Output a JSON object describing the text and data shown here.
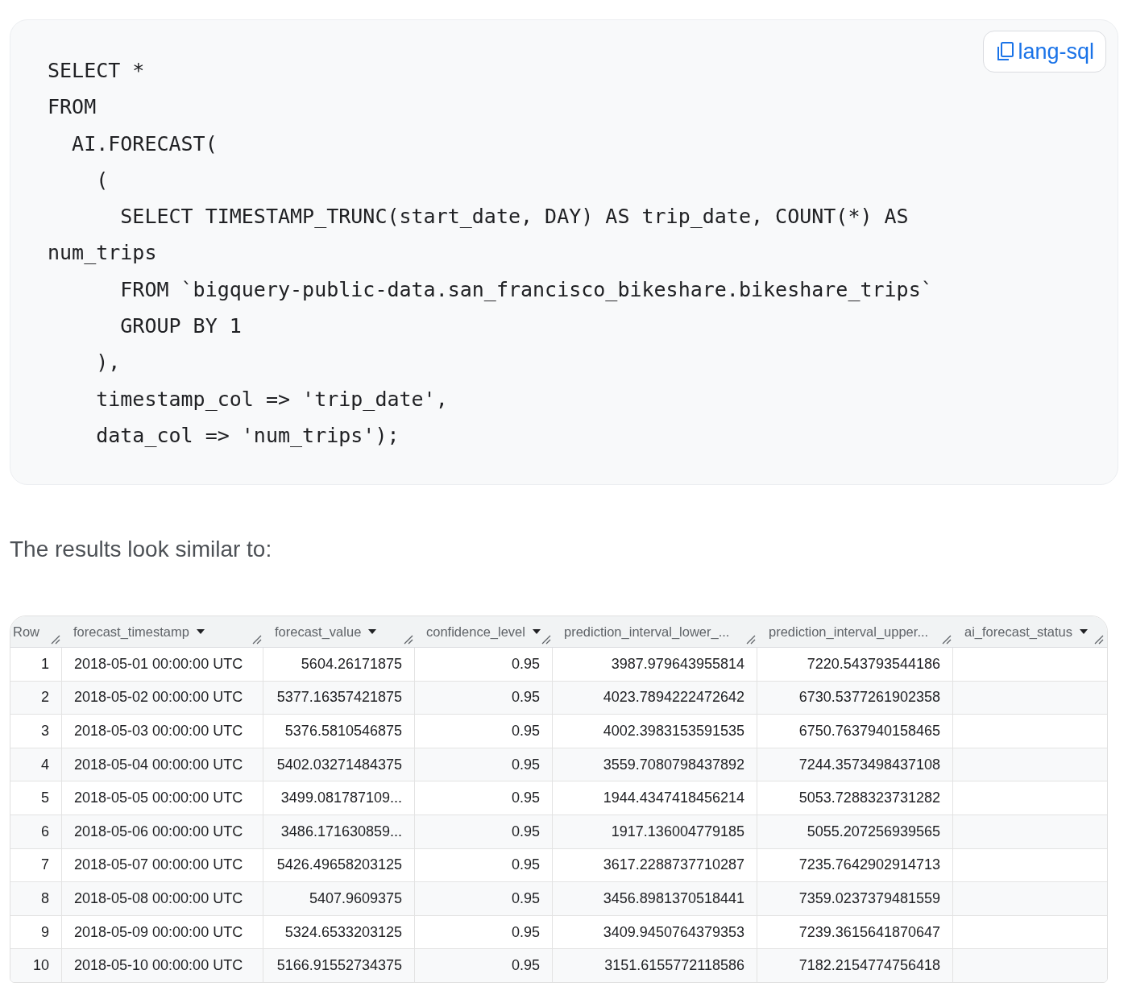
{
  "code_block": {
    "language_button": "lang-sql",
    "lines": [
      "SELECT *",
      "FROM",
      "  AI.FORECAST(",
      "    (",
      "      SELECT TIMESTAMP_TRUNC(start_date, DAY) AS trip_date, COUNT(*) AS",
      "num_trips",
      "      FROM `bigquery-public-data.san_francisco_bikeshare.bikeshare_trips`",
      "      GROUP BY 1",
      "    ),",
      "    timestamp_col => 'trip_date',",
      "    data_col => 'num_trips');"
    ]
  },
  "intro_text": "The results look similar to:",
  "table": {
    "columns": [
      {
        "label": "Row",
        "dropdown": false
      },
      {
        "label": "forecast_timestamp",
        "dropdown": true
      },
      {
        "label": "forecast_value",
        "dropdown": true
      },
      {
        "label": "confidence_level",
        "dropdown": true
      },
      {
        "label": "prediction_interval_lower_...",
        "dropdown": false
      },
      {
        "label": "prediction_interval_upper...",
        "dropdown": false
      },
      {
        "label": "ai_forecast_status",
        "dropdown": true
      }
    ],
    "rows": [
      [
        "1",
        "2018-05-01 00:00:00 UTC",
        "5604.26171875",
        "0.95",
        "3987.979643955814",
        "7220.543793544186"
      ],
      [
        "2",
        "2018-05-02 00:00:00 UTC",
        "5377.16357421875",
        "0.95",
        "4023.7894222472642",
        "6730.5377261902358"
      ],
      [
        "3",
        "2018-05-03 00:00:00 UTC",
        "5376.5810546875",
        "0.95",
        "4002.3983153591535",
        "6750.7637940158465"
      ],
      [
        "4",
        "2018-05-04 00:00:00 UTC",
        "5402.03271484375",
        "0.95",
        "3559.7080798437892",
        "7244.3573498437108"
      ],
      [
        "5",
        "2018-05-05 00:00:00 UTC",
        "3499.081787109...",
        "0.95",
        "1944.4347418456214",
        "5053.7288323731282"
      ],
      [
        "6",
        "2018-05-06 00:00:00 UTC",
        "3486.171630859...",
        "0.95",
        "1917.136004779185",
        "5055.207256939565"
      ],
      [
        "7",
        "2018-05-07 00:00:00 UTC",
        "5426.49658203125",
        "0.95",
        "3617.2288737710287",
        "7235.7642902914713"
      ],
      [
        "8",
        "2018-05-08 00:00:00 UTC",
        "5407.9609375",
        "0.95",
        "3456.8981370518441",
        "7359.0237379481559"
      ],
      [
        "9",
        "2018-05-09 00:00:00 UTC",
        "5324.6533203125",
        "0.95",
        "3409.9450764379353",
        "7239.3615641870647"
      ],
      [
        "10",
        "2018-05-10 00:00:00 UTC",
        "5166.91552734375",
        "0.95",
        "3151.6155772118586",
        "7182.2154774756418"
      ]
    ]
  }
}
